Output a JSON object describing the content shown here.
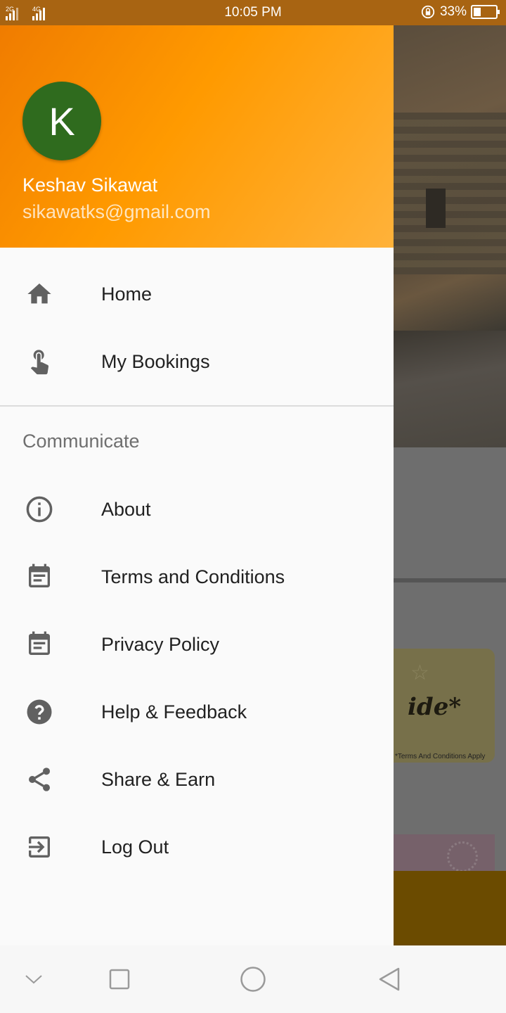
{
  "status_bar": {
    "network_1": "2G",
    "network_2": "4G",
    "time": "10:05 PM",
    "battery_percent": "33%",
    "battery_level": 0.33
  },
  "drawer": {
    "avatar_letter": "K",
    "user_name": "Keshav Sikawat",
    "user_email": "sikawatks@gmail.com",
    "primary_items": [
      {
        "label": "Home",
        "icon": "home-icon"
      },
      {
        "label": "My Bookings",
        "icon": "touch-icon"
      }
    ],
    "section_title": "Communicate",
    "secondary_items": [
      {
        "label": "About",
        "icon": "info-icon"
      },
      {
        "label": "Terms and Conditions",
        "icon": "calendar-note-icon"
      },
      {
        "label": "Privacy Policy",
        "icon": "calendar-note-icon"
      },
      {
        "label": "Help & Feedback",
        "icon": "help-icon"
      },
      {
        "label": "Share & Earn",
        "icon": "share-icon"
      },
      {
        "label": "Log Out",
        "icon": "logout-icon"
      }
    ]
  },
  "background": {
    "card_text": "ide*",
    "card_small_text": "*Terms And Conditions Apply"
  },
  "colors": {
    "header_gradient_start": "#f07c00",
    "header_gradient_end": "#ffb23a",
    "avatar_bg": "#2f6b1e",
    "icon_color": "#616161"
  }
}
